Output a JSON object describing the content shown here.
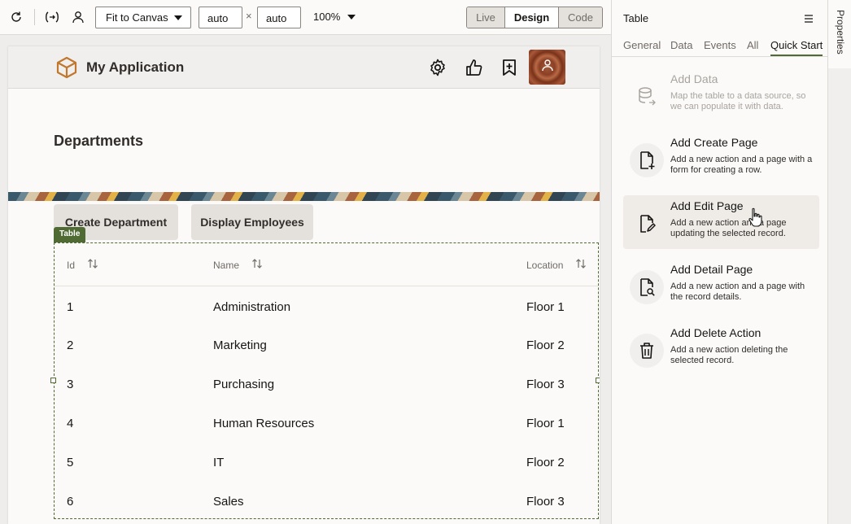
{
  "toolbar": {
    "fit_select": "Fit to Canvas",
    "width_value": "auto",
    "times": "×",
    "height_value": "auto",
    "zoom": "100%",
    "modes": [
      "Live",
      "Design",
      "Code"
    ],
    "active_mode": "Design"
  },
  "app": {
    "title": "My Application",
    "page_title": "Departments",
    "buttons": [
      "Create Department",
      "Display Employees"
    ],
    "table_tag": "Table",
    "columns": [
      "Id",
      "Name",
      "Location"
    ],
    "rows": [
      [
        "1",
        "Administration",
        "Floor 1"
      ],
      [
        "2",
        "Marketing",
        "Floor 2"
      ],
      [
        "3",
        "Purchasing",
        "Floor 3"
      ],
      [
        "4",
        "Human Resources",
        "Floor 1"
      ],
      [
        "5",
        "IT",
        "Floor 2"
      ],
      [
        "6",
        "Sales",
        "Floor 3"
      ]
    ]
  },
  "panel": {
    "title": "Table",
    "tabs": [
      "General",
      "Data",
      "Events",
      "All",
      "Quick Start"
    ],
    "active_tab": "Quick Start",
    "side_tab": "Properties",
    "quick_start": [
      {
        "title": "Add Data",
        "desc": "Map the table to a data source, so we can populate it with data.",
        "icon": "database-icon",
        "disabled": true
      },
      {
        "title": "Add Create Page",
        "desc": "Add a new action and a page with a form for creating a row.",
        "icon": "page-add-icon"
      },
      {
        "title": "Add Edit Page",
        "desc": "Add a new action and a page updating the selected record.",
        "icon": "page-edit-icon",
        "hover": true
      },
      {
        "title": "Add Detail Page",
        "desc": "Add a new action and a page with the record details.",
        "icon": "page-search-icon"
      },
      {
        "title": "Add Delete Action",
        "desc": "Add a new action deleting the selected record.",
        "icon": "trash-icon"
      }
    ]
  },
  "colors": {
    "accent": "#4f6b33",
    "logo": "#c0782f"
  }
}
